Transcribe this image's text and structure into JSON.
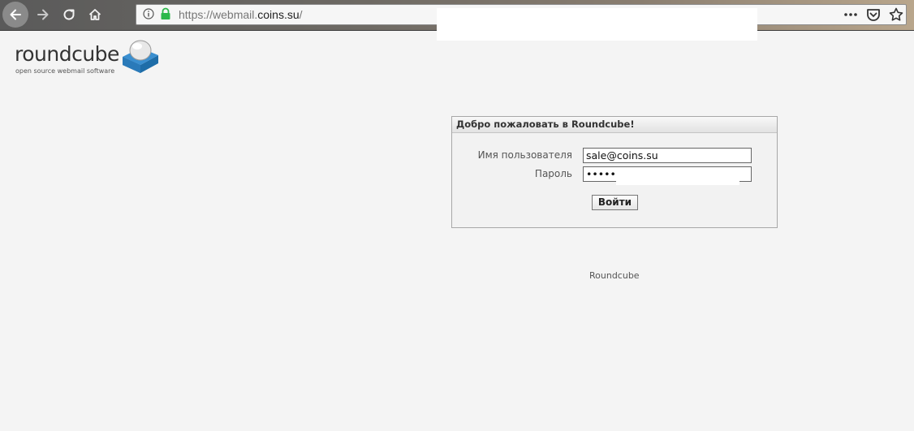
{
  "browser": {
    "url_scheme": "https://webmail.",
    "url_host": "coins.su",
    "url_rest": "/",
    "icons": {
      "back": "back-arrow-icon",
      "forward": "forward-arrow-icon",
      "reload": "reload-icon",
      "home": "home-icon",
      "info": "info-icon",
      "lock": "lock-icon",
      "more": "more-dots-icon",
      "pocket": "pocket-icon",
      "bookmark": "star-icon"
    },
    "lock_color": "#2db84b"
  },
  "logo": {
    "word": "roundcube",
    "tagline": "open source webmail software"
  },
  "login": {
    "title": "Добро пожаловать в Roundcube!",
    "username_label": "Имя пользователя",
    "username_value": "sale@coins.su",
    "password_label": "Пароль",
    "password_value": "•••••",
    "submit_label": "Войти"
  },
  "footer": {
    "text": "Roundcube"
  },
  "colors": {
    "page_bg": "#f4f4f4",
    "logo_blue": "#3a8fd0"
  }
}
